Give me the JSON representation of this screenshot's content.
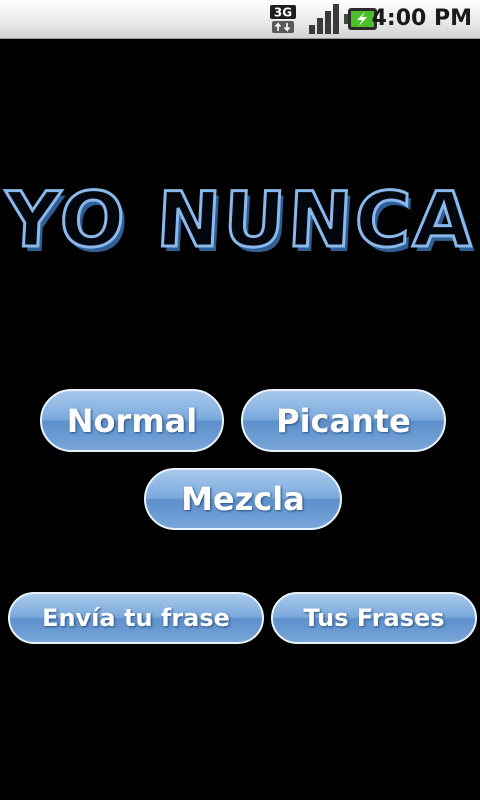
{
  "status_bar": {
    "time": "4:00 PM",
    "network_label": "3G",
    "icons": [
      "3g-data-icon",
      "signal-strength-icon",
      "battery-charging-icon"
    ]
  },
  "app": {
    "title": "YO NUNCA"
  },
  "buttons": {
    "normal": "Normal",
    "picante": "Picante",
    "mezcla": "Mezcla",
    "envia": "Envía tu frase",
    "tus_frases": "Tus Frases"
  },
  "colors": {
    "background": "#000000",
    "title_outline": "#8ab8ea",
    "button_fill": "#7ba9dc",
    "button_border": "#e9f2fb"
  }
}
